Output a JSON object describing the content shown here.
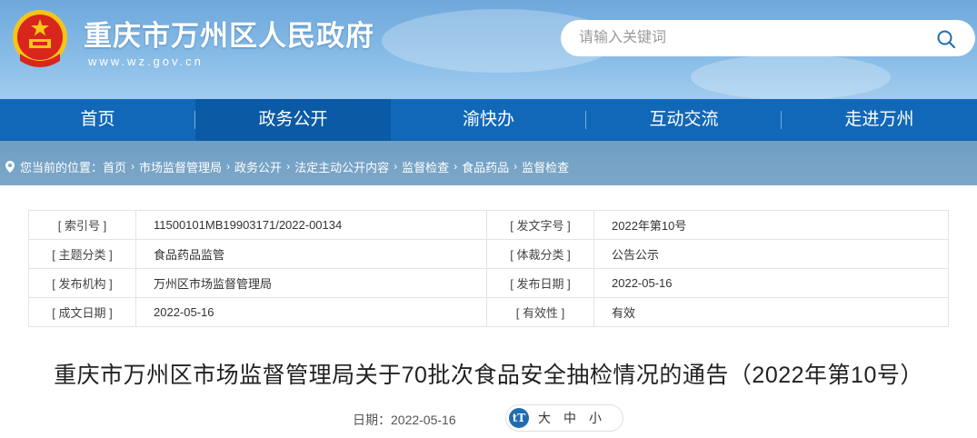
{
  "site": {
    "name": "重庆市万州区人民政府",
    "domain": "www.wz.gov.cn"
  },
  "search": {
    "placeholder": "请输入关键词"
  },
  "nav": {
    "items": [
      {
        "label": "首页"
      },
      {
        "label": "政务公开"
      },
      {
        "label": "渝快办"
      },
      {
        "label": "互动交流"
      },
      {
        "label": "走进万州"
      }
    ],
    "active_index": 1
  },
  "breadcrumb": {
    "prefix": "您当前的位置：",
    "items": [
      "首页",
      "市场监督管理局",
      "政务公开",
      "法定主动公开内容",
      "监督检查",
      "食品药品",
      "监督检查"
    ]
  },
  "info": {
    "rows": [
      {
        "l1": "[ 索引号 ]",
        "v1": "11500101MB19903171/2022-00134",
        "l2": "[ 发文字号 ]",
        "v2": "2022年第10号"
      },
      {
        "l1": "[ 主题分类 ]",
        "v1": "食品药品监管",
        "l2": "[ 体裁分类 ]",
        "v2": "公告公示"
      },
      {
        "l1": "[ 发布机构 ]",
        "v1": "万州区市场监督管理局",
        "l2": "[ 发布日期 ]",
        "v2": "2022-05-16"
      },
      {
        "l1": "[ 成文日期 ]",
        "v1": "2022-05-16",
        "l2": "[ 有效性 ]",
        "v2": "有效"
      }
    ]
  },
  "article": {
    "title": "重庆市万州区市场监督管理局关于70批次食品安全抽检情况的通告（2022年第10号）",
    "date_label": "日期：2022-05-16"
  },
  "font_size": {
    "icon_text": "tT",
    "options": [
      "大",
      "中",
      "小"
    ]
  },
  "colors": {
    "nav_bg": "#1268b8",
    "nav_active": "#0a5aa6",
    "emblem_red": "#d9261c",
    "emblem_gold": "#f5c518"
  }
}
